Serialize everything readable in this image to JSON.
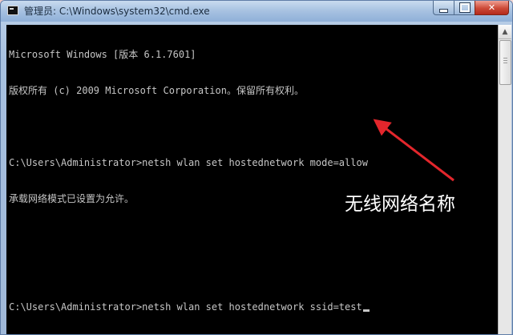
{
  "window": {
    "title": "管理员: C:\\Windows\\system32\\cmd.exe"
  },
  "controls": {
    "minimize": "",
    "maximize": "",
    "close": "✕"
  },
  "console": {
    "lines": [
      "Microsoft Windows [版本 6.1.7601]",
      "版权所有 (c) 2009 Microsoft Corporation。保留所有权利。",
      "",
      "C:\\Users\\Administrator>netsh wlan set hostednetwork mode=allow",
      "承载网络模式已设置为允许。",
      "",
      "",
      "C:\\Users\\Administrator>netsh wlan set hostednetwork ssid=test"
    ]
  },
  "annotation": {
    "label": "无线网络名称",
    "arrow_color": "#e3262c"
  },
  "icons": {
    "window_icon": "cmd-window-icon",
    "scroll_up": "up-arrow-icon"
  }
}
